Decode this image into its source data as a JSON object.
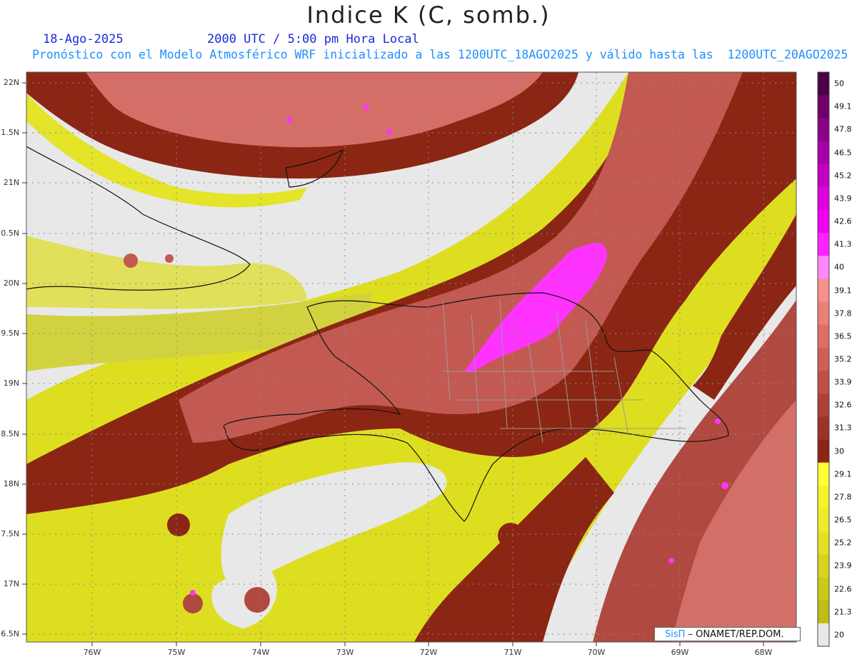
{
  "header": {
    "title": "Indice K (C, somb.)",
    "date": "18-Ago-2025",
    "time": "2000 UTC / 5:00 pm Hora Local",
    "model_info": "Pronóstico con el Modelo Atmosférico WRF inicializado a las 1200UTC_18AGO2025 y válido hasta las  1200UTC_20AGO2025"
  },
  "axes": {
    "lat_labels": [
      "22N",
      "1.5N",
      "21N",
      "0.5N",
      "20N",
      "9.5N",
      "19N",
      "8.5N",
      "18N",
      "7.5N",
      "17N",
      "6.5N"
    ],
    "lon_labels": [
      "76W",
      "75W",
      "74W",
      "73W",
      "72W",
      "71W",
      "70W",
      "69W",
      "68W"
    ]
  },
  "colorbar": {
    "labels": [
      "50",
      "49.1",
      "47.8",
      "46.5",
      "45.2",
      "43.9",
      "42.6",
      "41.3",
      "40",
      "39.1",
      "37.8",
      "36.5",
      "35.2",
      "33.9",
      "32.6",
      "31.3",
      "30",
      "29.1",
      "27.8",
      "26.5",
      "25.2",
      "23.9",
      "22.6",
      "21.3",
      "20"
    ],
    "colors": [
      "#4b0046",
      "#6e0068",
      "#8c0088",
      "#a800a8",
      "#c400c4",
      "#dd00dd",
      "#f000f0",
      "#ff22ff",
      "#ff88ff",
      "#f7908a",
      "#ec7f78",
      "#de6d66",
      "#cf5e57",
      "#bf4f47",
      "#ad4037",
      "#9b3327",
      "#8a2613",
      "#ffff33",
      "#f4f42c",
      "#ecec28",
      "#e2e223",
      "#d6d61e",
      "#caca19",
      "#bebe14",
      "#e8e8e8"
    ]
  },
  "credit": {
    "brand": "SisΠ",
    "text": " – ONAMET/REP.DOM."
  },
  "icons": {
    "map": "weather-map-icon"
  }
}
